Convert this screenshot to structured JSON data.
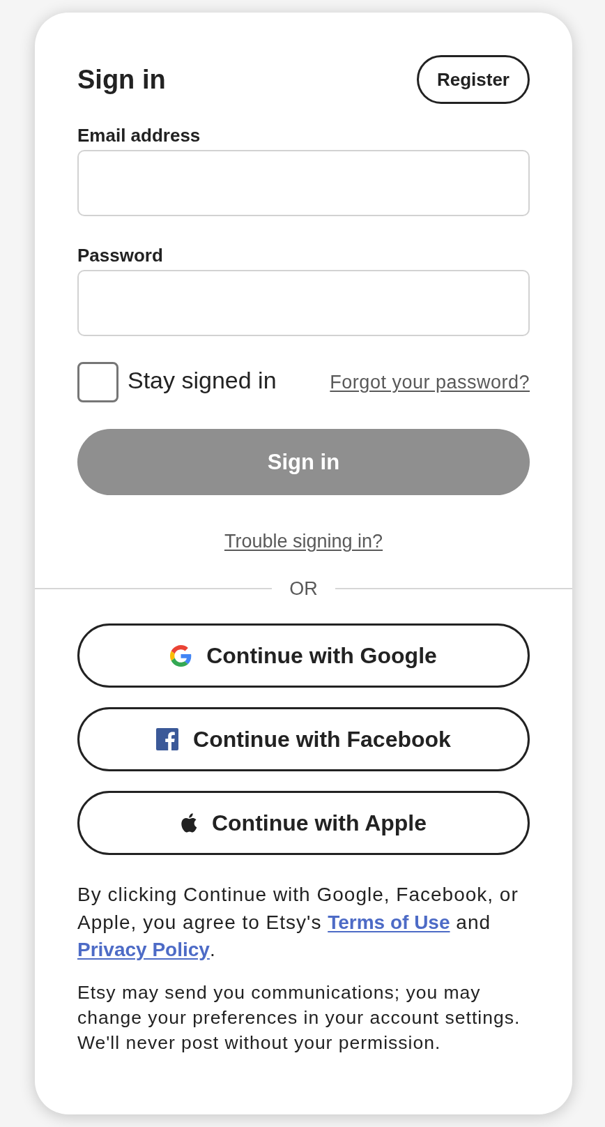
{
  "header": {
    "title": "Sign in",
    "register_button": "Register"
  },
  "fields": [
    {
      "label": "Email address"
    },
    {
      "label": "Password"
    }
  ],
  "stay_signed_in": {
    "label": "Stay signed in",
    "checked": false
  },
  "forgot_link": "Forgot your password?",
  "submit_button": {
    "label": "Sign in",
    "disabled": true
  },
  "trouble_link": "Trouble signing in?",
  "divider": "OR",
  "social_buttons": [
    {
      "kind": "google",
      "label": "Continue with Google"
    },
    {
      "kind": "facebook",
      "label": "Continue with Facebook"
    },
    {
      "kind": "apple",
      "label": "Continue with Apple"
    }
  ],
  "legal_text": [
    {
      "kind": "text",
      "text": "By clicking Continue with Google, Facebook, or Apple, you agree to Etsy's "
    },
    {
      "kind": "link",
      "text": "Terms of Use"
    },
    {
      "kind": "text",
      "text": " and "
    },
    {
      "kind": "link",
      "text": "Privacy Policy"
    },
    {
      "kind": "text",
      "text": "."
    }
  ],
  "notice": "Etsy may send you communications; you may change your preferences in your account settings. We'll never post without your permission."
}
